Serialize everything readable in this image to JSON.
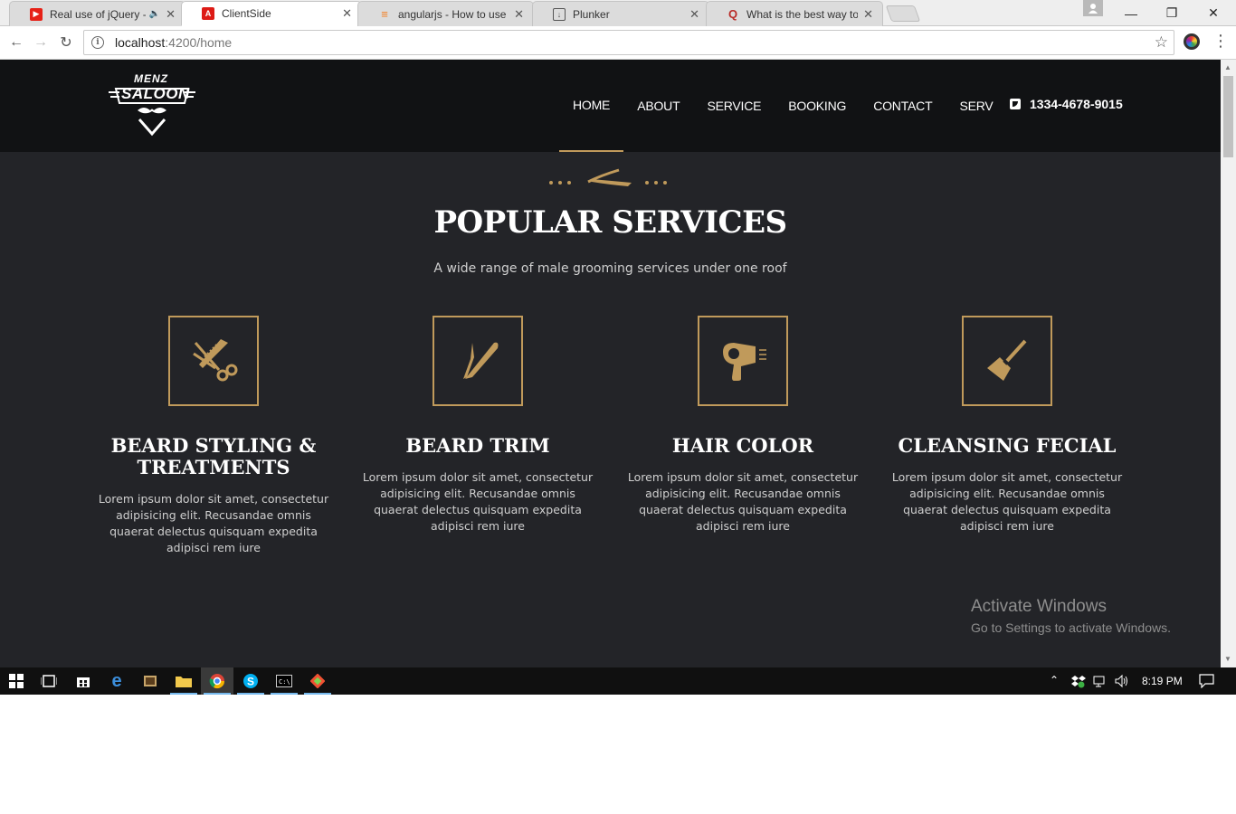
{
  "browser": {
    "tabs": [
      {
        "title": "Real use of jQuery - F",
        "favicon": "youtube-icon",
        "favicon_color": "#e62117",
        "active": false
      },
      {
        "title": "ClientSide",
        "favicon": "angular-icon",
        "favicon_color": "#dd1b16",
        "active": true
      },
      {
        "title": "angularjs - How to use o",
        "favicon": "stackoverflow-icon",
        "favicon_color": "#f48024",
        "active": false
      },
      {
        "title": "Plunker",
        "favicon": "plunker-icon",
        "favicon_color": "#555555",
        "active": false
      },
      {
        "title": "What is the best way to i",
        "favicon": "quora-icon",
        "favicon_color": "#b92b27",
        "active": false
      }
    ],
    "url_host": "localhost",
    "url_path": ":4200/home",
    "window_controls": {
      "minimize": "—",
      "restore": "❐",
      "close": "✕"
    }
  },
  "site": {
    "logo": {
      "line1": "MENZ",
      "line2": "SALOON"
    },
    "nav": [
      {
        "label": "HOME",
        "active": true
      },
      {
        "label": "ABOUT",
        "active": false
      },
      {
        "label": "SERVICE",
        "active": false
      },
      {
        "label": "BOOKING",
        "active": false
      },
      {
        "label": "CONTACT",
        "active": false
      },
      {
        "label": "SERV",
        "active": false
      }
    ],
    "phone": "1334-4678-9015",
    "accent_color": "#c09a5b",
    "section": {
      "title_light": "POPULAR",
      "title_bold": "SERVICES",
      "subtitle": "A wide range of male grooming services under one roof"
    },
    "services": [
      {
        "icon": "scissors-comb-icon",
        "title": "BEARD STYLING & TREATMENTS",
        "text": "Lorem ipsum dolor sit amet, consectetur adipisicing elit. Recusandae omnis quaerat delectus quisquam expedita adipisci rem iure"
      },
      {
        "icon": "straight-razor-icon",
        "title": "BEARD TRIM",
        "text": "Lorem ipsum dolor sit amet, consectetur adipisicing elit. Recusandae omnis quaerat delectus quisquam expedita adipisci rem iure"
      },
      {
        "icon": "hair-dryer-icon",
        "title": "HAIR COLOR",
        "text": "Lorem ipsum dolor sit amet, consectetur adipisicing elit. Recusandae omnis quaerat delectus quisquam expedita adipisci rem iure"
      },
      {
        "icon": "dye-brush-icon",
        "title": "CLEANSING FECIAL",
        "text": "Lorem ipsum dolor sit amet, consectetur adipisicing elit. Recusandae omnis quaerat delectus quisquam expedita adipisci rem iure"
      }
    ]
  },
  "watermark": {
    "line1": "Activate Windows",
    "line2": "Go to Settings to activate Windows."
  },
  "taskbar": {
    "time": "8:19 PM"
  }
}
